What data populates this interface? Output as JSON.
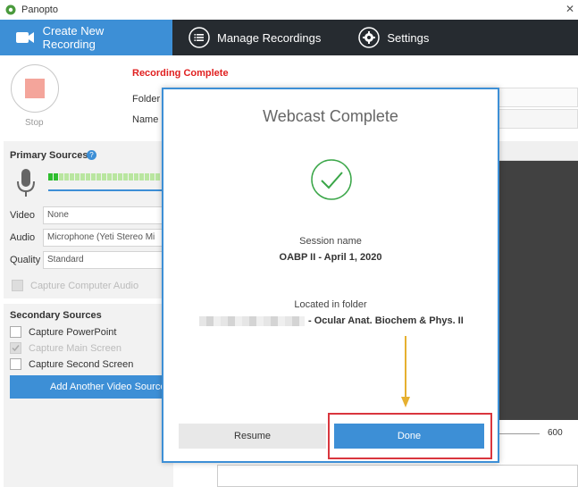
{
  "window": {
    "title": "Panopto"
  },
  "nav": {
    "tabs": [
      {
        "label": "Create New Recording",
        "icon": "camera-icon",
        "active": true
      },
      {
        "label": "Manage Recordings",
        "icon": "list-icon",
        "active": false
      },
      {
        "label": "Settings",
        "icon": "gear-icon",
        "active": false
      }
    ]
  },
  "recorder": {
    "stop_label": "Stop",
    "status": "Recording Complete",
    "folder_label": "Folder",
    "name_label": "Name"
  },
  "primary_sources": {
    "title": "Primary Sources",
    "help": "?",
    "video_label": "Video",
    "video_value": "None",
    "audio_label": "Audio",
    "audio_value": "Microphone (Yeti Stereo Mi",
    "quality_label": "Quality",
    "quality_value": "Standard",
    "capture_audio_label": "Capture Computer Audio"
  },
  "secondary_sources": {
    "title": "Secondary Sources",
    "powerpoint_label": "Capture PowerPoint",
    "main_screen_label": "Capture Main Screen",
    "second_screen_label": "Capture Second Screen",
    "add_video_label": "Add Another Video Source"
  },
  "preview": {
    "slider_max": "600"
  },
  "dialog": {
    "title": "Webcast Complete",
    "session_name_label": "Session name",
    "session_name": "OABP II - April 1, 2020",
    "folder_label": "Located in folder",
    "folder_value": "- Ocular Anat. Biochem & Phys. II",
    "resume_label": "Resume",
    "done_label": "Done"
  },
  "colors": {
    "accent": "#3d8fd6",
    "nav_bg": "#262b30",
    "status_red": "#e02020",
    "highlight_red": "#d9363e",
    "check_green": "#3aa648",
    "arrow_gold": "#e6b030"
  }
}
